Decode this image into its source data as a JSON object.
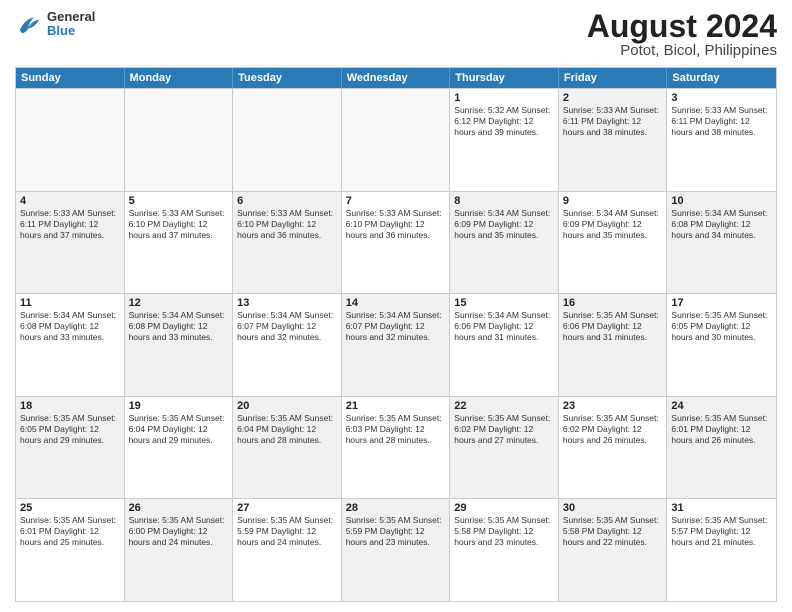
{
  "logo": {
    "line1": "General",
    "line2": "Blue"
  },
  "title": "August 2024",
  "subtitle": "Potot, Bicol, Philippines",
  "days_header": [
    "Sunday",
    "Monday",
    "Tuesday",
    "Wednesday",
    "Thursday",
    "Friday",
    "Saturday"
  ],
  "rows": [
    [
      {
        "day": "",
        "info": "",
        "empty": true
      },
      {
        "day": "",
        "info": "",
        "empty": true
      },
      {
        "day": "",
        "info": "",
        "empty": true
      },
      {
        "day": "",
        "info": "",
        "empty": true
      },
      {
        "day": "1",
        "info": "Sunrise: 5:32 AM\nSunset: 6:12 PM\nDaylight: 12 hours\nand 39 minutes.",
        "empty": false
      },
      {
        "day": "2",
        "info": "Sunrise: 5:33 AM\nSunset: 6:11 PM\nDaylight: 12 hours\nand 38 minutes.",
        "empty": false,
        "shaded": true
      },
      {
        "day": "3",
        "info": "Sunrise: 5:33 AM\nSunset: 6:11 PM\nDaylight: 12 hours\nand 38 minutes.",
        "empty": false
      }
    ],
    [
      {
        "day": "4",
        "info": "Sunrise: 5:33 AM\nSunset: 6:11 PM\nDaylight: 12 hours\nand 37 minutes.",
        "empty": false,
        "shaded": true
      },
      {
        "day": "5",
        "info": "Sunrise: 5:33 AM\nSunset: 6:10 PM\nDaylight: 12 hours\nand 37 minutes.",
        "empty": false
      },
      {
        "day": "6",
        "info": "Sunrise: 5:33 AM\nSunset: 6:10 PM\nDaylight: 12 hours\nand 36 minutes.",
        "empty": false,
        "shaded": true
      },
      {
        "day": "7",
        "info": "Sunrise: 5:33 AM\nSunset: 6:10 PM\nDaylight: 12 hours\nand 36 minutes.",
        "empty": false
      },
      {
        "day": "8",
        "info": "Sunrise: 5:34 AM\nSunset: 6:09 PM\nDaylight: 12 hours\nand 35 minutes.",
        "empty": false,
        "shaded": true
      },
      {
        "day": "9",
        "info": "Sunrise: 5:34 AM\nSunset: 6:09 PM\nDaylight: 12 hours\nand 35 minutes.",
        "empty": false
      },
      {
        "day": "10",
        "info": "Sunrise: 5:34 AM\nSunset: 6:08 PM\nDaylight: 12 hours\nand 34 minutes.",
        "empty": false,
        "shaded": true
      }
    ],
    [
      {
        "day": "11",
        "info": "Sunrise: 5:34 AM\nSunset: 6:08 PM\nDaylight: 12 hours\nand 33 minutes.",
        "empty": false
      },
      {
        "day": "12",
        "info": "Sunrise: 5:34 AM\nSunset: 6:08 PM\nDaylight: 12 hours\nand 33 minutes.",
        "empty": false,
        "shaded": true
      },
      {
        "day": "13",
        "info": "Sunrise: 5:34 AM\nSunset: 6:07 PM\nDaylight: 12 hours\nand 32 minutes.",
        "empty": false
      },
      {
        "day": "14",
        "info": "Sunrise: 5:34 AM\nSunset: 6:07 PM\nDaylight: 12 hours\nand 32 minutes.",
        "empty": false,
        "shaded": true
      },
      {
        "day": "15",
        "info": "Sunrise: 5:34 AM\nSunset: 6:06 PM\nDaylight: 12 hours\nand 31 minutes.",
        "empty": false
      },
      {
        "day": "16",
        "info": "Sunrise: 5:35 AM\nSunset: 6:06 PM\nDaylight: 12 hours\nand 31 minutes.",
        "empty": false,
        "shaded": true
      },
      {
        "day": "17",
        "info": "Sunrise: 5:35 AM\nSunset: 6:05 PM\nDaylight: 12 hours\nand 30 minutes.",
        "empty": false
      }
    ],
    [
      {
        "day": "18",
        "info": "Sunrise: 5:35 AM\nSunset: 6:05 PM\nDaylight: 12 hours\nand 29 minutes.",
        "empty": false,
        "shaded": true
      },
      {
        "day": "19",
        "info": "Sunrise: 5:35 AM\nSunset: 6:04 PM\nDaylight: 12 hours\nand 29 minutes.",
        "empty": false
      },
      {
        "day": "20",
        "info": "Sunrise: 5:35 AM\nSunset: 6:04 PM\nDaylight: 12 hours\nand 28 minutes.",
        "empty": false,
        "shaded": true
      },
      {
        "day": "21",
        "info": "Sunrise: 5:35 AM\nSunset: 6:03 PM\nDaylight: 12 hours\nand 28 minutes.",
        "empty": false
      },
      {
        "day": "22",
        "info": "Sunrise: 5:35 AM\nSunset: 6:02 PM\nDaylight: 12 hours\nand 27 minutes.",
        "empty": false,
        "shaded": true
      },
      {
        "day": "23",
        "info": "Sunrise: 5:35 AM\nSunset: 6:02 PM\nDaylight: 12 hours\nand 26 minutes.",
        "empty": false
      },
      {
        "day": "24",
        "info": "Sunrise: 5:35 AM\nSunset: 6:01 PM\nDaylight: 12 hours\nand 26 minutes.",
        "empty": false,
        "shaded": true
      }
    ],
    [
      {
        "day": "25",
        "info": "Sunrise: 5:35 AM\nSunset: 6:01 PM\nDaylight: 12 hours\nand 25 minutes.",
        "empty": false
      },
      {
        "day": "26",
        "info": "Sunrise: 5:35 AM\nSunset: 6:00 PM\nDaylight: 12 hours\nand 24 minutes.",
        "empty": false,
        "shaded": true
      },
      {
        "day": "27",
        "info": "Sunrise: 5:35 AM\nSunset: 5:59 PM\nDaylight: 12 hours\nand 24 minutes.",
        "empty": false
      },
      {
        "day": "28",
        "info": "Sunrise: 5:35 AM\nSunset: 5:59 PM\nDaylight: 12 hours\nand 23 minutes.",
        "empty": false,
        "shaded": true
      },
      {
        "day": "29",
        "info": "Sunrise: 5:35 AM\nSunset: 5:58 PM\nDaylight: 12 hours\nand 23 minutes.",
        "empty": false
      },
      {
        "day": "30",
        "info": "Sunrise: 5:35 AM\nSunset: 5:58 PM\nDaylight: 12 hours\nand 22 minutes.",
        "empty": false,
        "shaded": true
      },
      {
        "day": "31",
        "info": "Sunrise: 5:35 AM\nSunset: 5:57 PM\nDaylight: 12 hours\nand 21 minutes.",
        "empty": false
      }
    ]
  ]
}
